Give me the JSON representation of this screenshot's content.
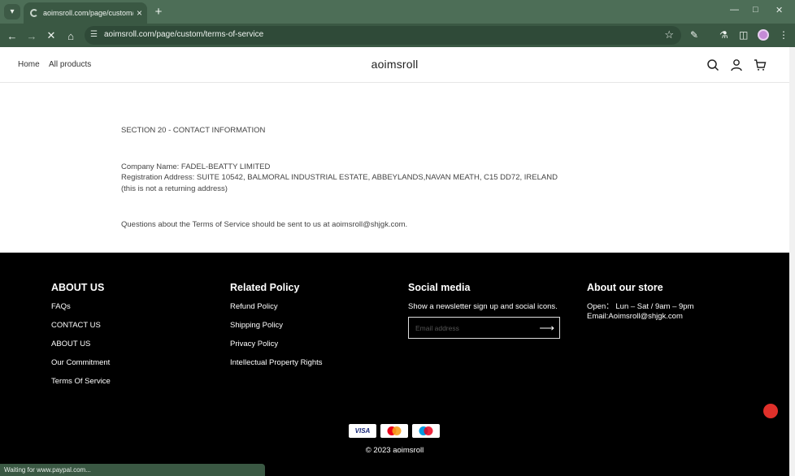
{
  "browser": {
    "tab_title": "aoimsroll.com/page/custom/te",
    "url": "aoimsroll.com/page/custom/terms-of-service",
    "status_text": "Waiting for www.paypal.com..."
  },
  "site": {
    "brand": "aoimsroll",
    "nav": [
      {
        "label": "Home"
      },
      {
        "label": "All products"
      }
    ]
  },
  "content": {
    "section_title": "SECTION 20 - CONTACT INFORMATION",
    "company_name": "Company Name: FADEL-BEATTY LIMITED",
    "registration_address": "Registration Address: SUITE 10542, BALMORAL INDUSTRIAL ESTATE, ABBEYLANDS,NAVAN MEATH, C15 DD72, IRELAND",
    "address_note": "(this is not a returning address)",
    "questions": "Questions about the Terms of Service should be sent to us at aoimsroll@shjgk.com."
  },
  "footer": {
    "about": {
      "heading": "ABOUT US",
      "links": [
        "FAQs",
        "CONTACT US",
        "ABOUT US",
        "Our Commitment",
        "Terms Of Service"
      ]
    },
    "policy": {
      "heading": "Related Policy",
      "links": [
        "Refund Policy",
        "Shipping Policy",
        "Privacy Policy",
        "Intellectual Property Rights"
      ]
    },
    "social": {
      "heading": "Social media",
      "text": "Show a newsletter sign up and social icons.",
      "email_placeholder": "Email address"
    },
    "store": {
      "heading": "About our store",
      "hours": "Open： Lun – Sat / 9am – 9pm",
      "email": "Email:Aoimsroll@shjgk.com"
    },
    "payments": [
      "visa-icon",
      "mastercard-icon",
      "maestro-icon"
    ],
    "visa_label": "VISA",
    "copyright": "© 2023 aoimsroll"
  },
  "colors": {
    "browser_frame": "#4d6e57",
    "footer_bg": "#000000",
    "chat_button": "#e0302a"
  }
}
